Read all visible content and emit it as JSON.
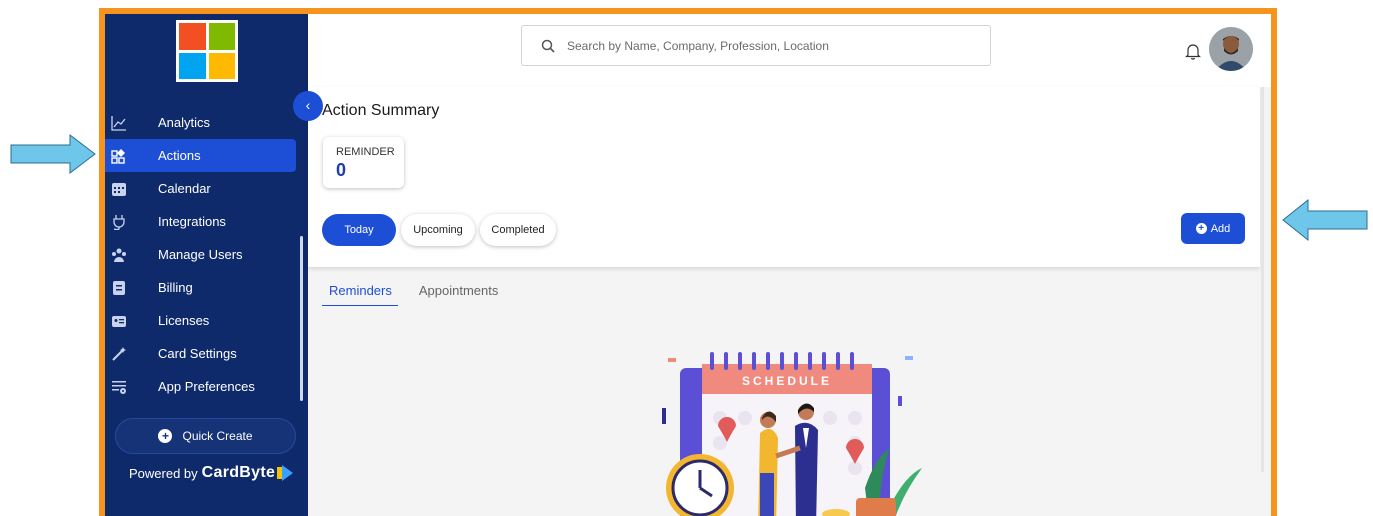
{
  "colors": {
    "frame": "#f7941d",
    "sidebar": "#0f2a6b",
    "accent": "#1c4fd6",
    "arrow": "#6ec6ea"
  },
  "logo": {
    "colors": [
      "#f25022",
      "#7fba00",
      "#00a4ef",
      "#ffb900"
    ]
  },
  "sidebar": {
    "items": [
      {
        "label": "Analytics",
        "icon": "chart-line-icon",
        "active": false
      },
      {
        "label": "Actions",
        "icon": "actions-grid-icon",
        "active": true
      },
      {
        "label": "Calendar",
        "icon": "calendar-icon",
        "active": false
      },
      {
        "label": "Integrations",
        "icon": "plug-icon",
        "active": false
      },
      {
        "label": "Manage Users",
        "icon": "users-icon",
        "active": false
      },
      {
        "label": "Billing",
        "icon": "billing-icon",
        "active": false
      },
      {
        "label": "Licenses",
        "icon": "license-card-icon",
        "active": false
      },
      {
        "label": "Card Settings",
        "icon": "magic-wand-icon",
        "active": false
      },
      {
        "label": "App Preferences",
        "icon": "preferences-icon",
        "active": false
      }
    ],
    "quick_create": "Quick Create",
    "powered_by": "Powered by",
    "brand": "CardByte"
  },
  "header": {
    "search_placeholder": "Search by Name, Company, Profession, Location"
  },
  "summary": {
    "title": "Action Summary",
    "reminder_label": "REMINDER",
    "reminder_count": "0",
    "filters": [
      "Today",
      "Upcoming",
      "Completed"
    ],
    "add_label": "Add"
  },
  "tabs": [
    "Reminders",
    "Appointments"
  ],
  "illustration": {
    "banner_text": "SCHEDULE"
  }
}
